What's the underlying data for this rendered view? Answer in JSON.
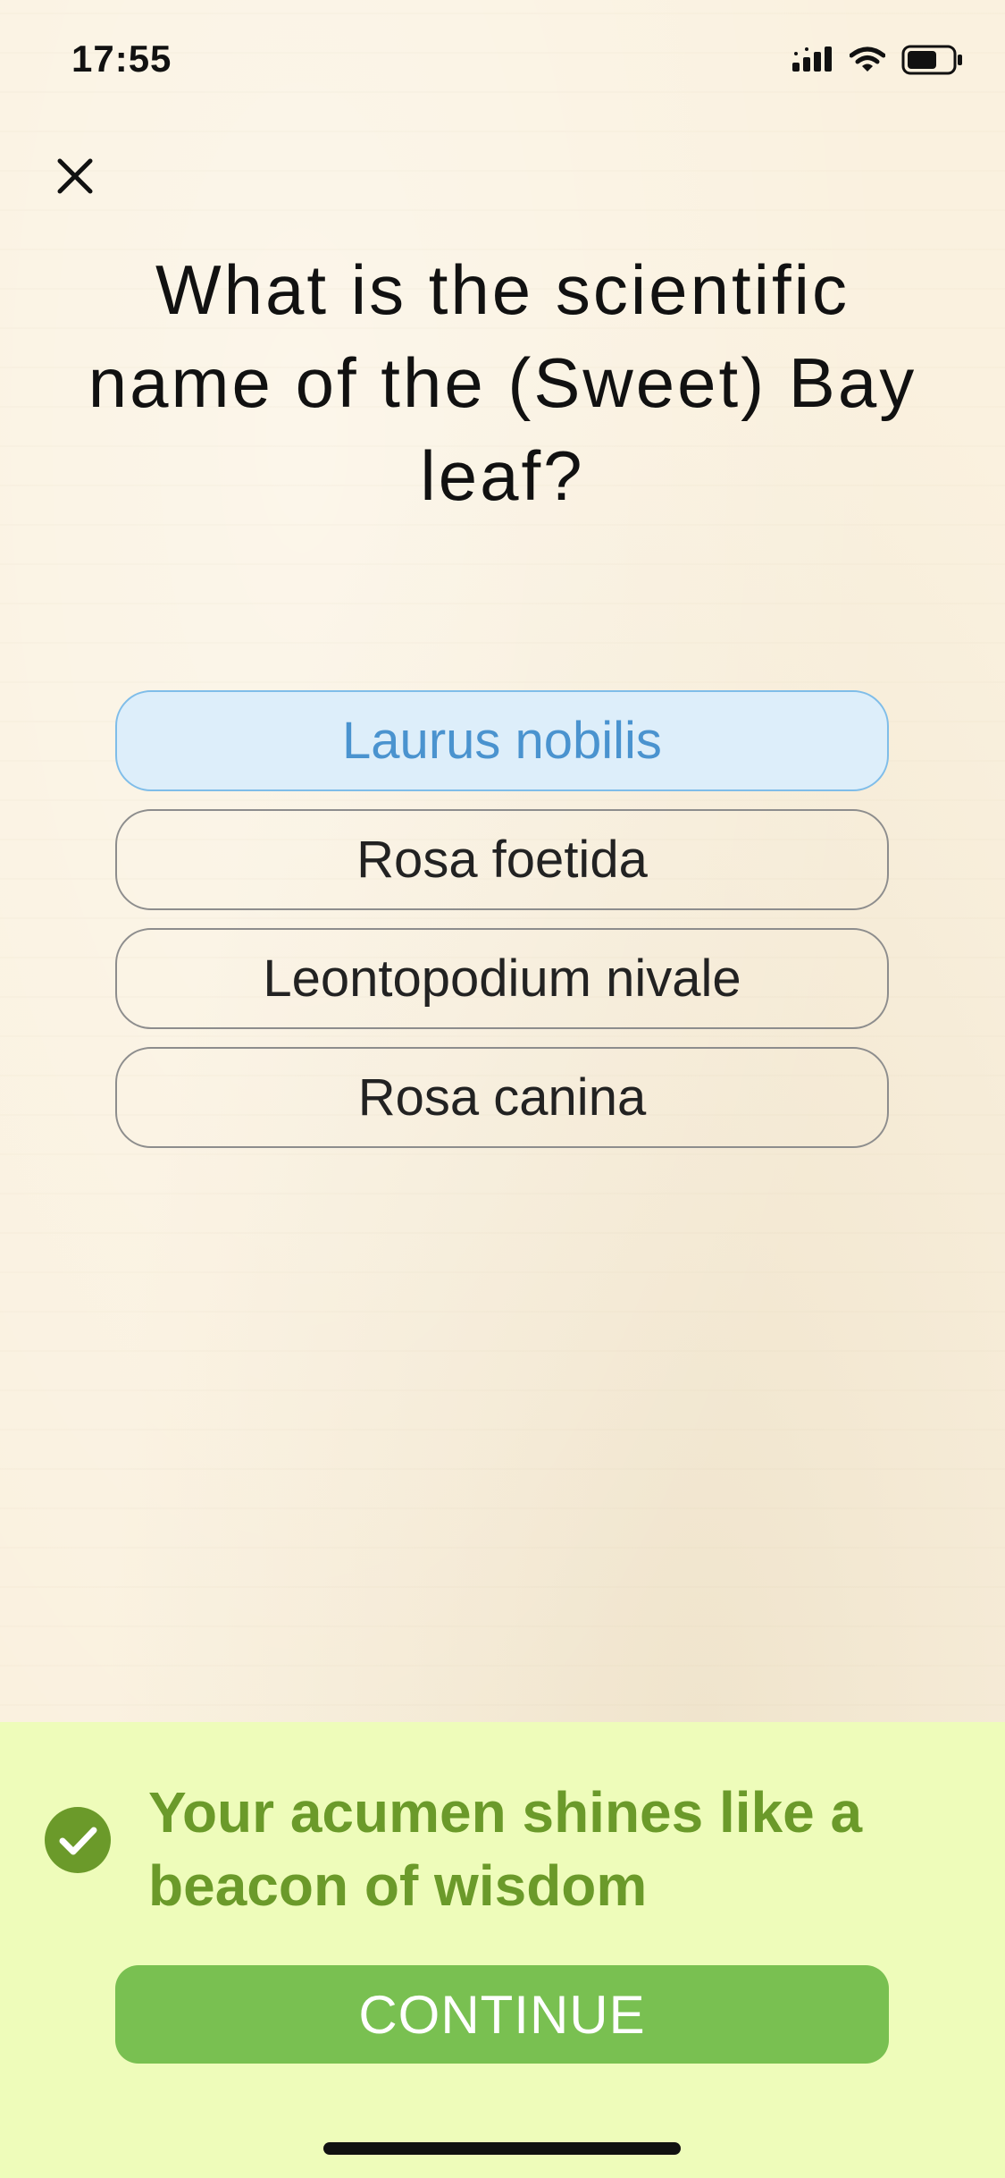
{
  "status_bar": {
    "time": "17:55"
  },
  "close": {
    "icon": "close-icon"
  },
  "question": {
    "text": "What is the scientific name of the (Sweet) Bay leaf?"
  },
  "options": [
    {
      "label": "Laurus nobilis",
      "selected": true
    },
    {
      "label": "Rosa foetida",
      "selected": false
    },
    {
      "label": "Leontopodium nivale",
      "selected": false
    },
    {
      "label": "Rosa canina",
      "selected": false
    }
  ],
  "feedback": {
    "icon": "check-circle-icon",
    "message": "Your acumen shines like a beacon of wisdom",
    "continue_label": "CONTINUE"
  },
  "colors": {
    "selected_option_bg": "#ddeefa",
    "selected_option_text": "#4a93cf",
    "feedback_bg": "#eefcba",
    "feedback_text": "#6b9a2a",
    "continue_button": "#79c051"
  }
}
